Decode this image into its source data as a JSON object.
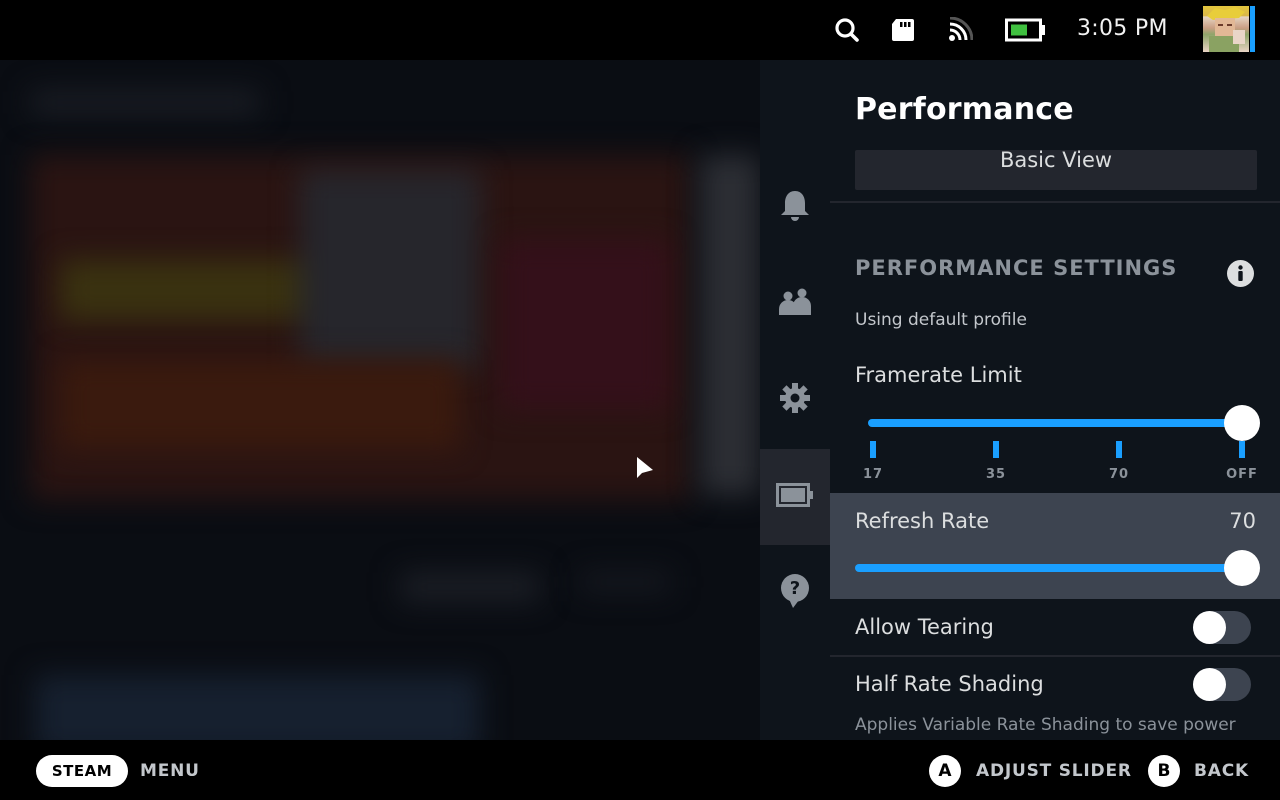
{
  "status_bar": {
    "icons": [
      "search-icon",
      "sd-card-icon",
      "wifi-icon",
      "battery-icon"
    ],
    "time": "3:05 PM",
    "battery_color": "#40c040",
    "accent_color": "#1a9fff"
  },
  "side_nav": {
    "items": [
      {
        "name": "notifications",
        "icon": "bell-icon",
        "active": false
      },
      {
        "name": "friends",
        "icon": "friends-icon",
        "active": false
      },
      {
        "name": "settings",
        "icon": "gear-icon",
        "active": false
      },
      {
        "name": "performance",
        "icon": "battery-icon",
        "active": true
      },
      {
        "name": "help",
        "icon": "help-icon",
        "active": false
      }
    ]
  },
  "panel": {
    "title": "Performance",
    "basic_view_label": "Basic View",
    "section_heading": "PERFORMANCE SETTINGS",
    "profile_text": "Using default profile",
    "framerate": {
      "label": "Framerate Limit",
      "ticks": [
        "17",
        "35",
        "70",
        "OFF"
      ],
      "selected": "OFF",
      "fraction": 1.0
    },
    "refresh_rate": {
      "label": "Refresh Rate",
      "value": "70",
      "fraction": 1.0
    },
    "allow_tearing": {
      "label": "Allow Tearing",
      "enabled": false
    },
    "half_rate_shading": {
      "label": "Half Rate Shading",
      "enabled": false,
      "description": "Applies Variable Rate Shading to save power"
    }
  },
  "footer": {
    "steam_label": "STEAM",
    "menu_label": "MENU",
    "a_button": "A",
    "a_action": "ADJUST SLIDER",
    "b_button": "B",
    "b_action": "BACK"
  }
}
